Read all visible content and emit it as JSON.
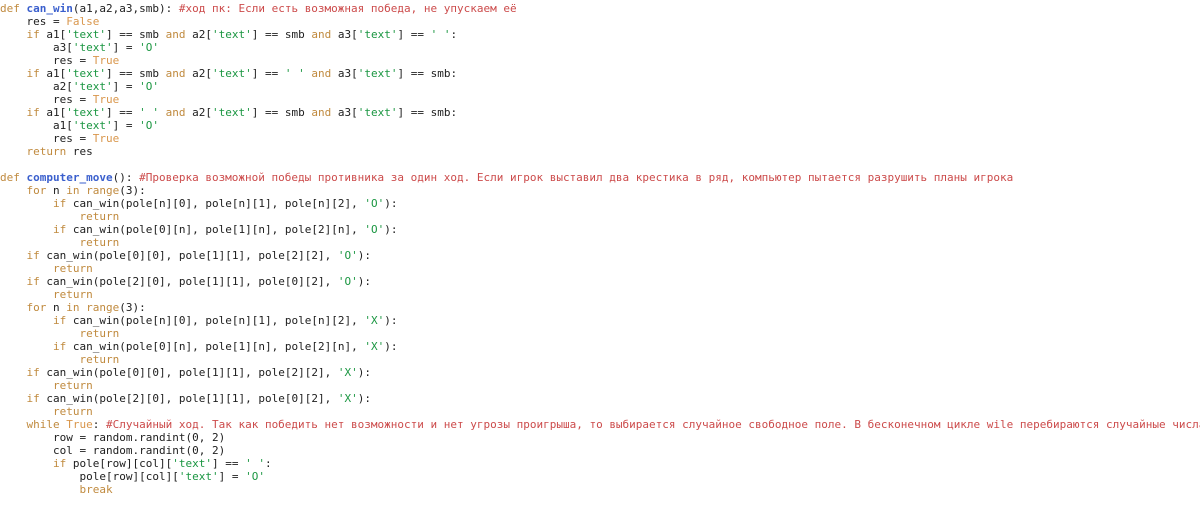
{
  "editor": {
    "language": "Python",
    "background_color": "#ffffff",
    "font_size_px": 11,
    "line_height_px": 13,
    "colors": {
      "keyword": "#c08a3e",
      "function_name": "#3a5fcd",
      "string": "#1a9641",
      "comment": "#cc4b4b",
      "boolean": "#d9964b",
      "plain_text": "#202020"
    }
  },
  "code": {
    "lines": [
      "def can_win(a1,a2,a3,smb): #ход пк: Если есть возможная победа, не упускаем её",
      "    res = False",
      "    if a1['text'] == smb and a2['text'] == smb and a3['text'] == ' ':",
      "        a3['text'] = 'O'",
      "        res = True",
      "    if a1['text'] == smb and a2['text'] == ' ' and a3['text'] == smb:",
      "        a2['text'] = 'O'",
      "        res = True",
      "    if a1['text'] == ' ' and a2['text'] == smb and a3['text'] == smb:",
      "        a1['text'] = 'O'",
      "        res = True",
      "    return res",
      "",
      "def computer_move(): #Проверка возможной победы противника за один ход. Если игрок выставил два крестика в ряд, компьютер пытается разрушить планы игрока",
      "    for n in range(3):",
      "        if can_win(pole[n][0], pole[n][1], pole[n][2], 'O'):",
      "            return",
      "        if can_win(pole[0][n], pole[1][n], pole[2][n], 'O'):",
      "            return",
      "    if can_win(pole[0][0], pole[1][1], pole[2][2], 'O'):",
      "        return",
      "    if can_win(pole[2][0], pole[1][1], pole[0][2], 'O'):",
      "        return",
      "    for n in range(3):",
      "        if can_win(pole[n][0], pole[n][1], pole[n][2], 'X'):",
      "            return",
      "        if can_win(pole[0][n], pole[1][n], pole[2][n], 'X'):",
      "            return",
      "    if can_win(pole[0][0], pole[1][1], pole[2][2], 'X'):",
      "        return",
      "    if can_win(pole[2][0], pole[1][1], pole[0][2], 'X'):",
      "        return",
      "    while True: #Случайный ход. Так как победить нет возможности и нет угрозы проигрыша, то выбирается случайное свободное поле. В бесконечном цикле wile перебираются случайные числа,",
      "        row = random.randint(0, 2)",
      "        col = random.randint(0, 2)",
      "        if pole[row][col]['text'] == ' ':",
      "            pole[row][col]['text'] = 'O'",
      "            break"
    ],
    "tokens": {
      "keywords": [
        "def",
        "if",
        "for",
        "in",
        "while",
        "return",
        "break",
        "and"
      ],
      "builtins": [
        "range",
        "random",
        "randint"
      ],
      "booleans": [
        "True",
        "False"
      ],
      "function_names": [
        "can_win",
        "computer_move"
      ],
      "strings": [
        "'text'",
        "'O'",
        "'X'",
        "' '"
      ],
      "identifiers": [
        "a1",
        "a2",
        "a3",
        "smb",
        "res",
        "pole",
        "n",
        "row",
        "col"
      ]
    },
    "comments": [
      "#ход пк: Если есть возможная победа, не упускаем её",
      "#Проверка возможной победы противника за один ход. Если игрок выставил два крестика в ряд, компьютер пытается разрушить планы игрока",
      "#Случайный ход. Так как победить нет возможности и нет угрозы проигрыша, то выбирается случайное свободное поле. В бесконечном цикле wile перебираются случайные числа,"
    ]
  }
}
